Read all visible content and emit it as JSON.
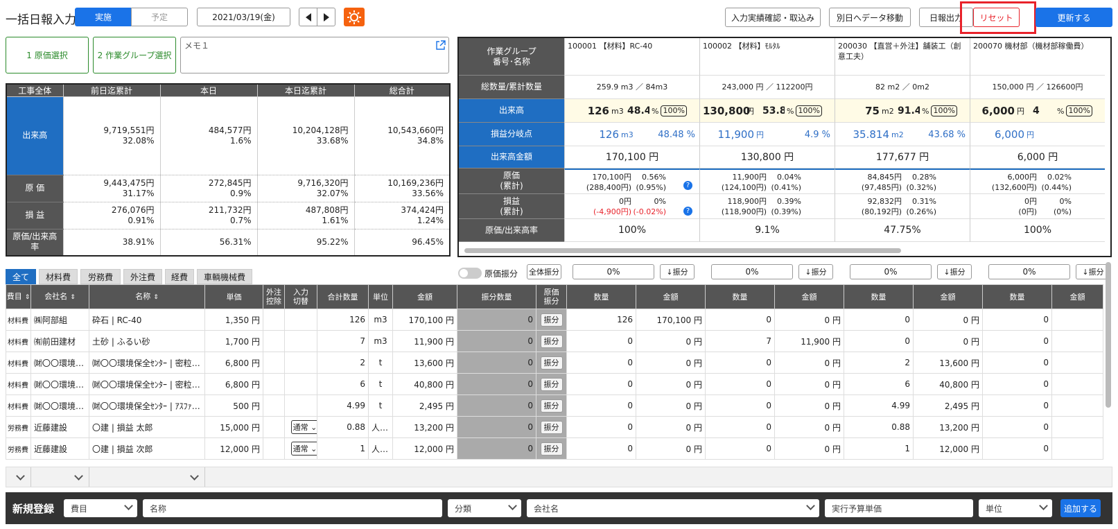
{
  "header": {
    "title": "一括日報入力",
    "toggle_on": "実施",
    "toggle_off": "予定",
    "date": "2021/03/19(金)",
    "btn_confirm": "入力実績確認・取込み",
    "btn_move": "別日へデータ移動",
    "btn_report": "日報出力",
    "btn_reset": "リセット",
    "btn_update": "更新する"
  },
  "filters": {
    "cost_select": "1 原価選択",
    "group_select": "2 作業グループ選択",
    "memo_placeholder": "メモ１"
  },
  "summary": {
    "headers": [
      "工事全体",
      "前日迄累計",
      "本日",
      "本日迄累計",
      "総合計"
    ],
    "rows": [
      {
        "label": "出来高",
        "vals": [
          [
            "9,719,551円",
            "32.08%"
          ],
          [
            "484,577円",
            "1.6%"
          ],
          [
            "10,204,128円",
            "33.68%"
          ],
          [
            "10,543,660円",
            "34.8%"
          ]
        ]
      },
      {
        "label": "原 価",
        "vals": [
          [
            "9,443,475円",
            "31.17%"
          ],
          [
            "272,845円",
            "0.9%"
          ],
          [
            "9,716,320円",
            "32.07%"
          ],
          [
            "10,169,236円",
            "33.56%"
          ]
        ]
      },
      {
        "label": "損 益",
        "vals": [
          [
            "276,076円",
            "0.91%"
          ],
          [
            "211,732円",
            "0.7%"
          ],
          [
            "487,808円",
            "1.61%"
          ],
          [
            "374,424円",
            "1.24%"
          ]
        ]
      },
      {
        "label": "原価/出来高率",
        "vals": [
          [
            "38.91%",
            ""
          ],
          [
            "56.31%",
            ""
          ],
          [
            "95.22%",
            ""
          ],
          [
            "96.45%",
            ""
          ]
        ]
      }
    ]
  },
  "groups": {
    "labels": [
      "作業グループ\n番号･名称",
      "総数量/累計数量",
      "出来高",
      "損益分岐点",
      "出来高金額",
      "原価\n(累計)",
      "損益\n(累計)",
      "原価/出来高率"
    ],
    "pct_label": "100%",
    "cols": [
      {
        "name": "100001 【材料】RC-40",
        "total": "259.9 m3 ／ 84m3",
        "qty": "126",
        "unit": "m3",
        "rate": "48.48",
        "be_qty": "126",
        "be_unit": "m3",
        "be_rate": "48.48 %",
        "amount": "170,100 円",
        "cost1": "170,100円",
        "cost1p": "0.56%",
        "cost2": "(288,400円)",
        "cost2p": "(0.95%)",
        "pl1": "0円",
        "pl1p": "0%",
        "pl2": "(-4,900円)",
        "pl2p": "(-0.02%)",
        "ratio": "100%"
      },
      {
        "name": "100002 【材料】ﾓﾙﾀﾙ",
        "total": "243,000 円 ／ 112200円",
        "qty": "130,800",
        "unit": "円",
        "rate": "53.83",
        "be_qty": "11,900",
        "be_unit": "円",
        "be_rate": "4.9 %",
        "amount": "130,800 円",
        "cost1": "11,900円",
        "cost1p": "0.04%",
        "cost2": "(124,100円)",
        "cost2p": "(0.41%)",
        "pl1": "118,900円",
        "pl1p": "0.39%",
        "pl2": "(118,900円)",
        "pl2p": "(0.39%)",
        "ratio": "9.1%"
      },
      {
        "name": "200030 【直営＋外注】舗装工（創意工夫）",
        "total": "82 m2 ／ 0m2",
        "qty": "75",
        "unit": "m2",
        "rate": "91.46",
        "be_qty": "35.814",
        "be_unit": "m2",
        "be_rate": "43.68 %",
        "amount": "177,677 円",
        "cost1": "84,845円",
        "cost1p": "0.28%",
        "cost2": "(97,485円)",
        "cost2p": "(0.32%)",
        "pl1": "92,832円",
        "pl1p": "0.31%",
        "pl2": "(80,192円)",
        "pl2p": "(0.26%)",
        "ratio": "47.75%"
      },
      {
        "name": "200070 機材部（機材部稼働費）",
        "total": "150,000 円 ／ 126600円",
        "qty": "6,000",
        "unit": "円",
        "rate": "4",
        "be_qty": "6,000",
        "be_unit": "円",
        "be_rate": "",
        "amount": "6,000 円",
        "cost1": "6,000円",
        "cost1p": "0.02%",
        "cost2": "(132,600円)",
        "cost2p": "(0.44%)",
        "pl1": "0円",
        "pl1p": "0%",
        "pl2": "(0円)",
        "pl2p": "(0%)",
        "ratio": "100%"
      }
    ]
  },
  "tabs": [
    "全て",
    "材料費",
    "労務費",
    "外注費",
    "経費",
    "車輌機械費"
  ],
  "alloc": {
    "toggle_label": "原価振分",
    "all_btn": "全体振分",
    "col_pcts": [
      "0%",
      "0%",
      "0%",
      "0%"
    ],
    "col_btn": "↓振分"
  },
  "table": {
    "headers": [
      "費目",
      "会社名",
      "名称",
      "単価",
      "外注\n控除",
      "入力\n切替",
      "合計数量",
      "単位",
      "金額",
      "振分数量",
      "原価\n振分",
      "数量",
      "金額",
      "数量",
      "金額",
      "数量",
      "金額",
      "数量",
      "金額"
    ],
    "alloc_btn": "振分",
    "rows": [
      [
        "材料費",
        "㈱阿部組",
        "砕石 | RC-40",
        "1,350 円",
        "",
        "",
        "126",
        "m3",
        "170,100 円",
        "0",
        "126",
        "170,100 円",
        "0",
        "0 円",
        "0",
        "0 円",
        "0",
        ""
      ],
      [
        "材料費",
        "㈲前田建材",
        "土砂 | ふるい砂",
        "1,700 円",
        "",
        "",
        "7",
        "m3",
        "11,900 円",
        "0",
        "0",
        "0 円",
        "7",
        "11,900 円",
        "0",
        "0 円",
        "0",
        ""
      ],
      [
        "材料費",
        "㈶〇〇環境保…",
        "㈶〇〇環境保全ｾﾝﾀｰ | 密粒度再…",
        "6,800 円",
        "",
        "",
        "2",
        "t",
        "13,600 円",
        "0",
        "0",
        "0 円",
        "0",
        "0 円",
        "2",
        "13,600 円",
        "0",
        ""
      ],
      [
        "材料費",
        "㈶〇〇環境保…",
        "㈶〇〇環境保全ｾﾝﾀｰ | 密粒度ｱｽ…",
        "6,800 円",
        "",
        "",
        "6",
        "t",
        "40,800 円",
        "0",
        "0",
        "0 円",
        "0",
        "0 円",
        "6",
        "40,800 円",
        "0",
        ""
      ],
      [
        "材料費",
        "㈶〇〇環境保…",
        "㈶〇〇環境保全ｾﾝﾀｰ | ｱｽﾌｧﾙﾄ廃材",
        "500 円",
        "",
        "",
        "4.99",
        "t",
        "2,495 円",
        "0",
        "0",
        "0 円",
        "0",
        "0 円",
        "4.99",
        "2,495 円",
        "0",
        ""
      ],
      [
        "労務費",
        "近藤建設",
        "〇建 | 損益 太郎",
        "15,000 円",
        "",
        "通常",
        "0.88",
        "人/日",
        "13,200 円",
        "0",
        "0",
        "0 円",
        "0",
        "0 円",
        "0.88",
        "13,200 円",
        "0",
        ""
      ],
      [
        "労務費",
        "近藤建設",
        "〇建 | 損益 次郎",
        "12,000 円",
        "",
        "通常",
        "1",
        "人/日",
        "12,000 円",
        "0",
        "0",
        "0 円",
        "0",
        "0 円",
        "1",
        "12,000 円",
        "0",
        ""
      ]
    ]
  },
  "new_entry": {
    "title": "新規登録",
    "cost_type": "費目",
    "name": "名称",
    "category": "分類",
    "company": "会社名",
    "budget_price": "実行予算単価",
    "unit": "単位",
    "add_btn": "追加する"
  }
}
